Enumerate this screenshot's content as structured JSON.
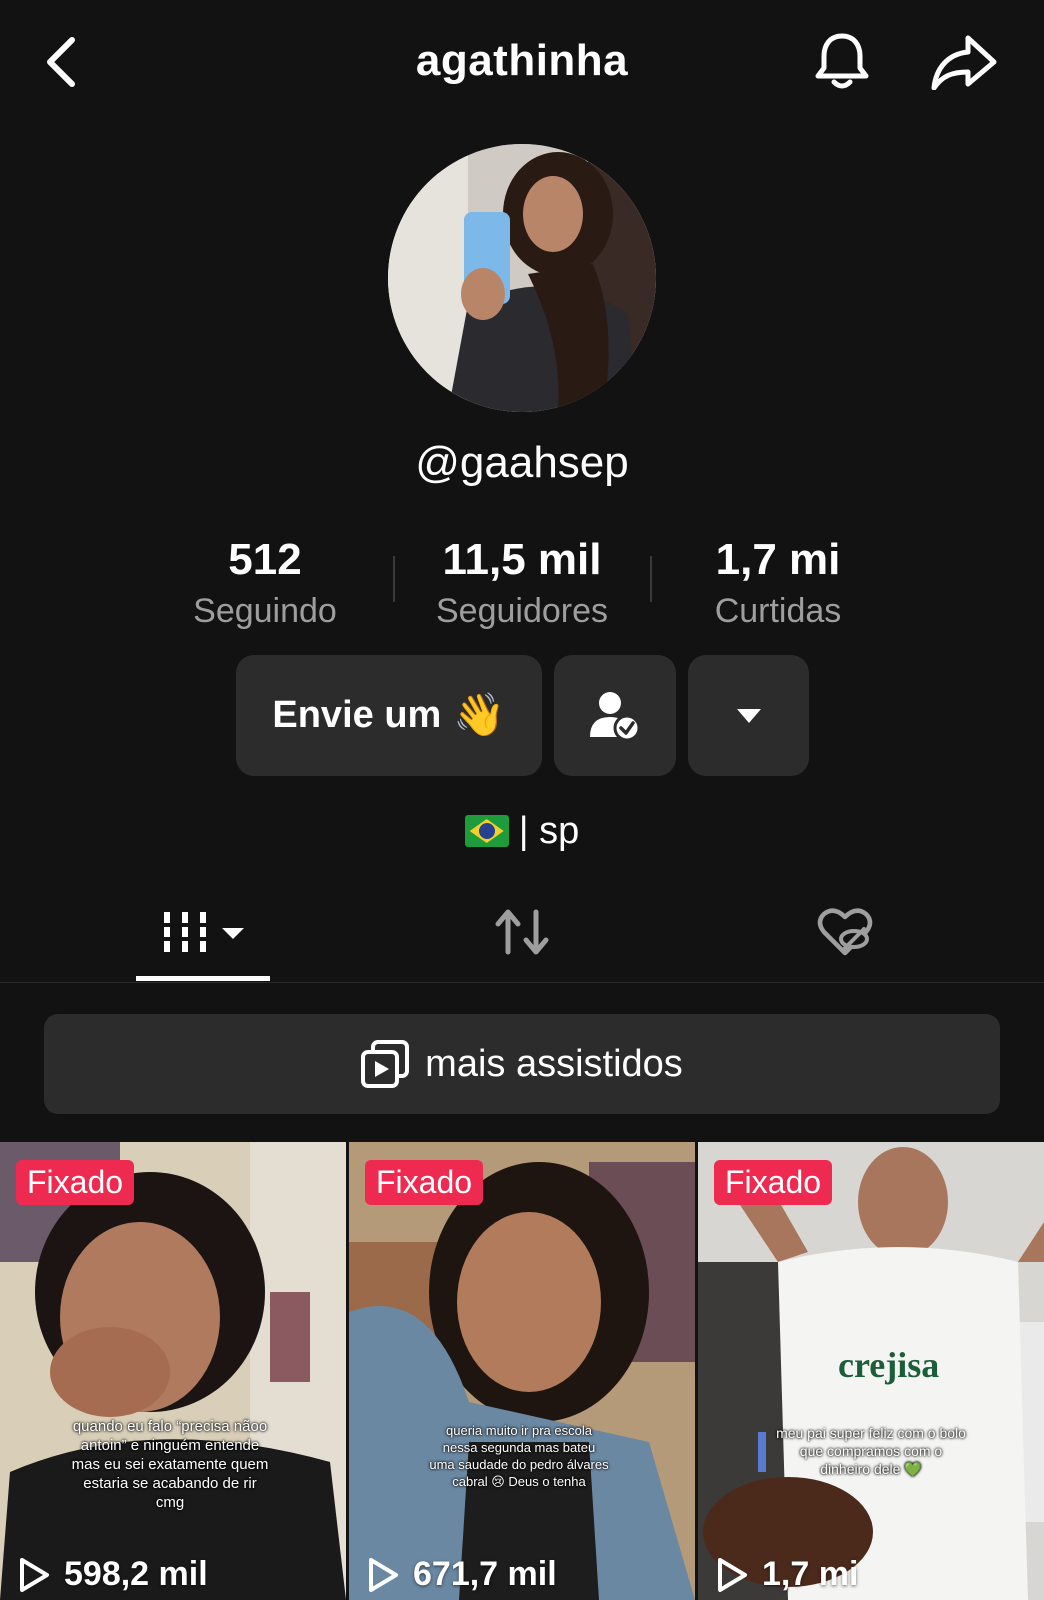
{
  "header": {
    "title": "agathinha"
  },
  "profile": {
    "handle": "@gaahsep"
  },
  "stats": [
    {
      "value": "512",
      "label": "Seguindo"
    },
    {
      "value": "11,5 mil",
      "label": "Seguidores"
    },
    {
      "value": "1,7 mi",
      "label": "Curtidas"
    }
  ],
  "actions": {
    "message_label": "Envie um",
    "message_emoji": "👋"
  },
  "bio": {
    "text": "| sp",
    "flag": "brazil-flag"
  },
  "playlist": {
    "label": "mais assistidos"
  },
  "videos": [
    {
      "badge": "Fixado",
      "caption": "quando eu falo “precisa nãoo antoin” e ninguém entende mas eu sei exatamente quem estaria se acabando de rir cmg",
      "views": "598,2 mil"
    },
    {
      "badge": "Fixado",
      "caption": "queria muito ir pra escola nessa segunda mas bateu uma saudade do pedro álvares cabral 😢 Deus o tenha",
      "views": "671,7 mil"
    },
    {
      "badge": "Fixado",
      "caption": "meu pai super feliz com o bolo que compramos com o dinheiro dele 💚",
      "views": "1,7 mi"
    }
  ],
  "colors": {
    "background": "#121212",
    "button": "#2c2c2c",
    "pinned": "#ef2a50",
    "muted_text": "#9e9e9e"
  }
}
